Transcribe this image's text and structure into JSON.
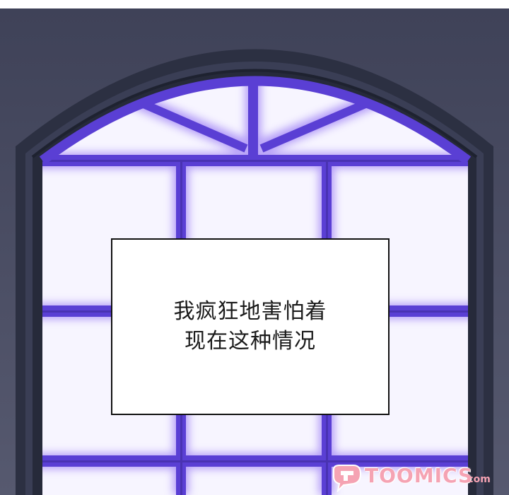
{
  "caption": {
    "lines": [
      "我疯狂地害怕着",
      "现在这种情况"
    ]
  },
  "watermark": {
    "brand": "TOOMICS",
    "suffix": ".com",
    "icon": "toomics-logo-icon"
  },
  "colors": {
    "wall": "#4a4d66",
    "frame": "#2f3345",
    "mullion_glow": "#7a5cf0",
    "glass": "#f7f5ff",
    "watermark": "#f5a3b3"
  }
}
